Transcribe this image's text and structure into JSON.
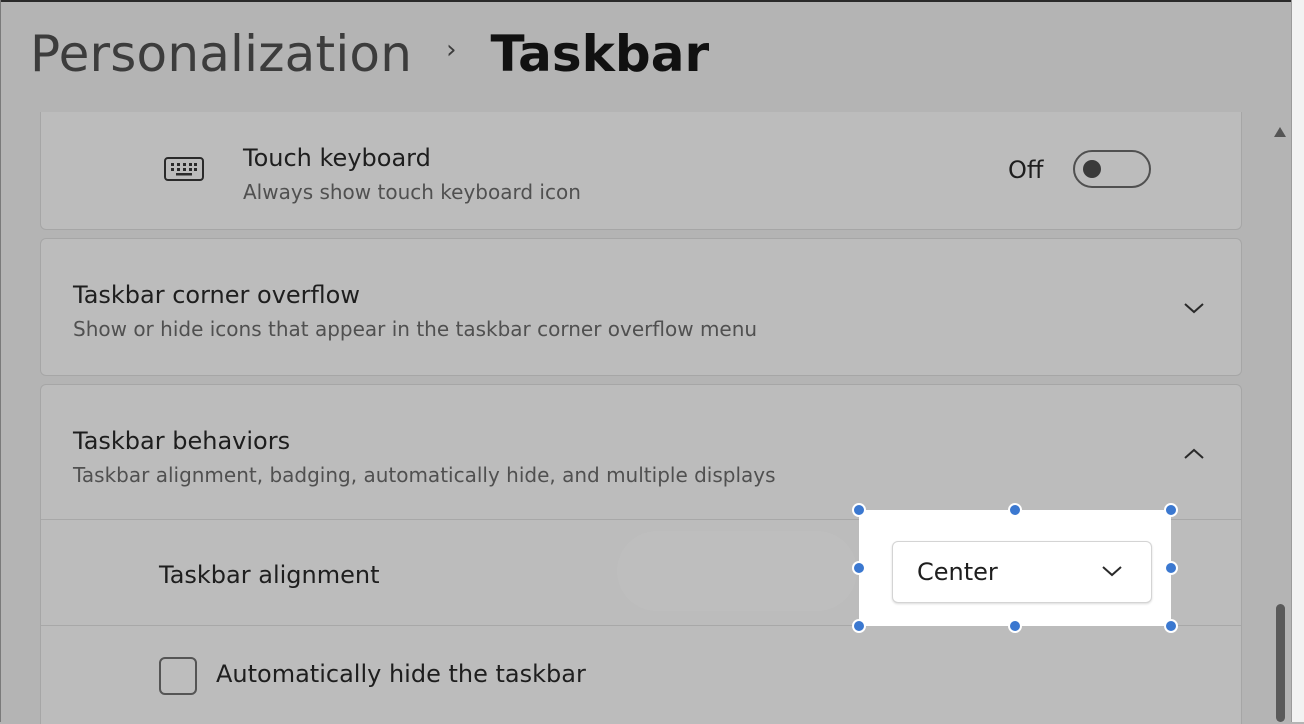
{
  "breadcrumb": {
    "parent": "Personalization",
    "separator": "›",
    "current": "Taskbar"
  },
  "touch_keyboard": {
    "icon": "keyboard-icon",
    "title": "Touch keyboard",
    "subtitle": "Always show touch keyboard icon",
    "toggle_label": "Off",
    "toggle_on": false
  },
  "corner_overflow": {
    "title": "Taskbar corner overflow",
    "subtitle": "Show or hide icons that appear in the taskbar corner overflow menu",
    "expanded": false
  },
  "behaviors": {
    "title": "Taskbar behaviors",
    "subtitle": "Taskbar alignment, badging, automatically hide, and multiple displays",
    "expanded": true,
    "alignment": {
      "label": "Taskbar alignment",
      "value": "Center"
    },
    "auto_hide": {
      "label": "Automatically hide the taskbar",
      "checked": false
    }
  },
  "colors": {
    "selection_handle": "#3b78d0",
    "dimmed_background": "#b4b4b4"
  }
}
